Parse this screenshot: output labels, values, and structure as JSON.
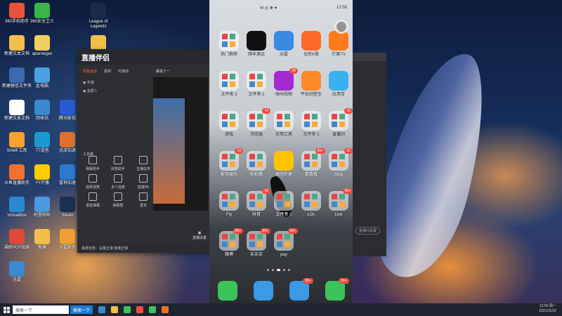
{
  "desktop": {
    "icons": [
      {
        "label": "360手机助手",
        "color": "#e9523a"
      },
      {
        "label": "360安全卫士",
        "color": "#3ab54a"
      },
      {
        "label": "League of Legends",
        "color": "#1b2a4a"
      },
      {
        "label": "新建文本文档",
        "color": "#f0c04a"
      },
      {
        "label": "aparnegao",
        "color": "#f0d060"
      },
      {
        "label": "新建文件夹 (2)",
        "color": "#f0c04a"
      },
      {
        "label": "新建微信文件夹",
        "color": "#3a6ab0"
      },
      {
        "label": "此电脑",
        "color": "#4aa0e0"
      },
      {
        "label": "微软2000",
        "color": "#6a4aa0"
      },
      {
        "label": "新建文本文档",
        "color": "#ffffff"
      },
      {
        "label": "回收站",
        "color": "#3a8ad0"
      },
      {
        "label": "腾讯影视",
        "color": "#2a5ad0"
      },
      {
        "label": "SAMF工具",
        "color": "#ffa030"
      },
      {
        "label": "TT语音",
        "color": "#1a9ad0"
      },
      {
        "label": "迅游加速",
        "color": "#e07030"
      },
      {
        "label": "斗鱼直播助手",
        "color": "#f07030"
      },
      {
        "label": "YY开播",
        "color": "#ffcc00"
      },
      {
        "label": "雷神加速",
        "color": "#2a7ad0"
      },
      {
        "label": "VirtualBox",
        "color": "#2a8ad0"
      },
      {
        "label": "阿里旺旺",
        "color": "#4a9ae0"
      },
      {
        "label": "Steam",
        "color": "#1a3050"
      },
      {
        "label": "福昕PDF阅读",
        "color": "#e04a3a"
      },
      {
        "label": "新建",
        "color": "#f0c04a"
      },
      {
        "label": "迅雷影音",
        "color": "#f0a030"
      },
      {
        "label": "迅雷",
        "color": "#3a8ad0"
      }
    ]
  },
  "assistant": {
    "logo": "直播伴侣",
    "tabs": [
      "场景画面",
      "素材",
      "可滚动"
    ],
    "scene_name": "解说十一",
    "scene_items": [
      "手游",
      "全屏 1"
    ],
    "tools_title": "工具箱",
    "tools": [
      "弹幕助手",
      "房管助手",
      "主播任务",
      "视频连麦",
      "多人连麦",
      "直播PK",
      "语音弹幕",
      "弹幕帮",
      "更多"
    ],
    "live_button": "直播设置",
    "footer": "系统状态：设置正常 帧率正常"
  },
  "phone": {
    "time": "12:56",
    "apps": [
      {
        "label": "热门推荐",
        "folder": true,
        "badge": ""
      },
      {
        "label": "顺丰速运",
        "color": "#111111",
        "badge": ""
      },
      {
        "label": "迅雷",
        "color": "#3a8ae0",
        "badge": ""
      },
      {
        "label": "全民K歌",
        "color": "#ff6a2a",
        "badge": ""
      },
      {
        "label": "芒果TV",
        "color": "#ff7a1a",
        "badge": ""
      },
      {
        "label": "文件夹 3",
        "folder": true,
        "badge": ""
      },
      {
        "label": "文件夹 1",
        "folder": true,
        "badge": ""
      },
      {
        "label": "咪咕视频",
        "color": "#a52ad0",
        "badge": "99"
      },
      {
        "label": "平安好医生",
        "color": "#ff8a2a",
        "badge": ""
      },
      {
        "label": "应用宝",
        "color": "#3ab0f0",
        "badge": ""
      },
      {
        "label": "游戏",
        "folder": true,
        "badge": ""
      },
      {
        "label": "浏览器",
        "folder": true,
        "badge": "14"
      },
      {
        "label": "实用工具",
        "folder": true,
        "badge": ""
      },
      {
        "label": "文件夹 2",
        "folder": true,
        "badge": ""
      },
      {
        "label": "直播间",
        "folder": true,
        "badge": "16"
      },
      {
        "label": "影音娱乐",
        "folder": true,
        "badge": "10"
      },
      {
        "label": "拍拍照",
        "folder": true,
        "badge": ""
      },
      {
        "label": "美团外卖",
        "color": "#ffc300",
        "badge": ""
      },
      {
        "label": "看看看",
        "folder": true,
        "badge": "99+"
      },
      {
        "label": "Sing",
        "folder": true,
        "badge": "31"
      },
      {
        "label": "Fly",
        "folder": true,
        "badge": ""
      },
      {
        "label": "抖音",
        "folder": true,
        "badge": "42"
      },
      {
        "label": "文件夹 2",
        "folder": true,
        "badge": ""
      },
      {
        "label": "LOL",
        "folder": true,
        "badge": ""
      },
      {
        "label": "Live",
        "folder": true,
        "badge": "99+"
      },
      {
        "label": "微博",
        "folder": true,
        "badge": "99+"
      },
      {
        "label": "买买买",
        "folder": true,
        "badge": "99+"
      },
      {
        "label": "pay",
        "folder": true,
        "badge": "99+"
      }
    ],
    "dock": [
      {
        "label": "phone",
        "color": "#3bc45a",
        "badge": ""
      },
      {
        "label": "contacts",
        "color": "#3a9ae8",
        "badge": ""
      },
      {
        "label": "messages",
        "color": "#3a9ae8",
        "badge": "99+"
      },
      {
        "label": "wechat",
        "color": "#3bc45a",
        "badge": "99+"
      }
    ]
  },
  "right_window": {
    "button": "直播间设置"
  },
  "taskbar": {
    "search_placeholder": "搜索一下",
    "search_button": "搜索一下",
    "time": "12:56 周一",
    "date": "2021/11/22"
  }
}
